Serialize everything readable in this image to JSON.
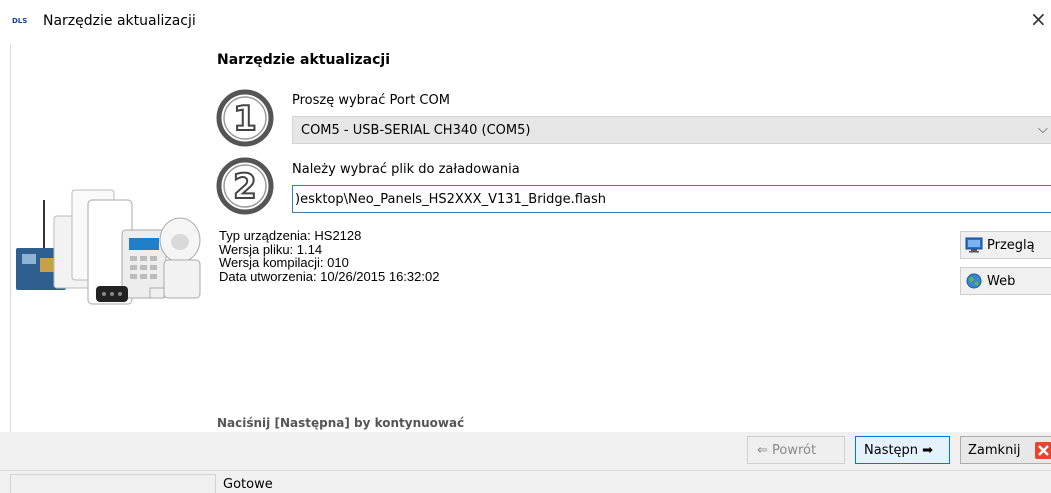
{
  "window": {
    "logo_text": "DLS",
    "title": "Narzędzie aktualizacji",
    "close_glyph": "×"
  },
  "main": {
    "title": "Narzędzie aktualizacji",
    "step1": {
      "number": "1",
      "label": "Proszę wybrać Port COM",
      "selected": "COM5 - USB-SERIAL CH340 (COM5)",
      "arrow": "⌵"
    },
    "step2": {
      "number": "2",
      "label": "Należy wybrać plik do załadowania",
      "value": ")esktop\\Neo_Panels_HS2XXX_V131_Bridge.flash"
    },
    "info": {
      "device_type": "Typ urządzenia: HS2128",
      "file_version": "Wersja pliku: 1.14",
      "build_version": "Wersja kompilacji: 010",
      "created": "Data utworzenia: 10/26/2015 16:32:02"
    },
    "buttons": {
      "browse": "Przeglą",
      "web": "Web"
    },
    "hint": "Naciśnij [Następna] by kontynuować"
  },
  "footer": {
    "back_label": "⇐ Powrót",
    "next_label": "Następn ➡",
    "close_label": "Zamknij"
  },
  "status": {
    "text": "Gotowe"
  },
  "colors": {
    "accent": "#0078d7",
    "input_border": "#3c7fb1",
    "logo": "#1c3f8a",
    "close_icon": "#e8452b"
  }
}
